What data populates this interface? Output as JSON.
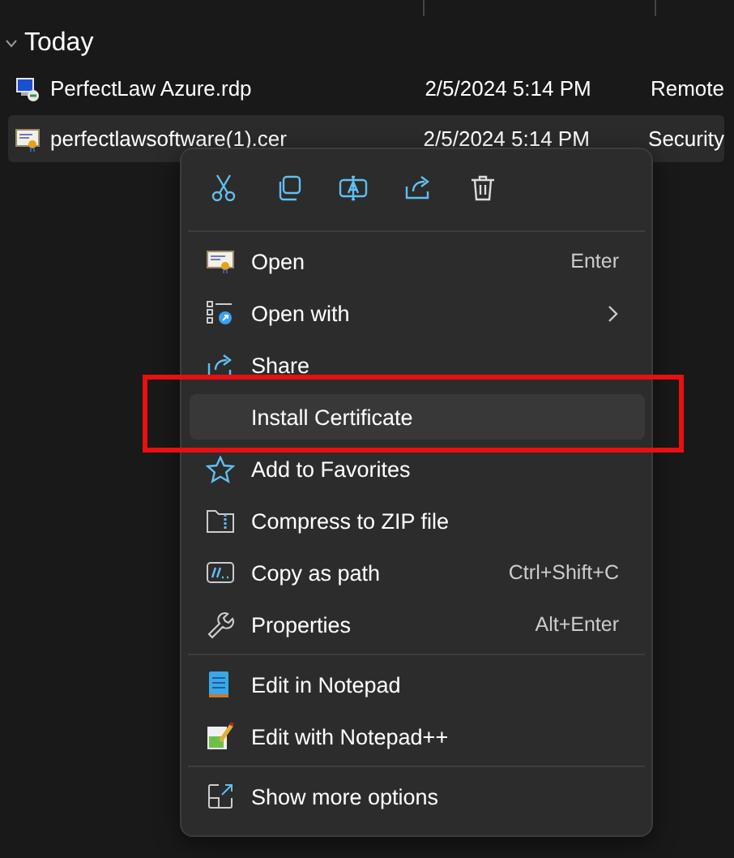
{
  "group": {
    "label": "Today",
    "expanded": true
  },
  "files": [
    {
      "name": "PerfectLaw Azure.rdp",
      "date": "2/5/2024 5:14 PM",
      "type": "Remote",
      "selected": false
    },
    {
      "name": "perfectlawsoftware(1).cer",
      "date": "2/5/2024 5:14 PM",
      "type": "Security",
      "selected": true
    }
  ],
  "context_menu": {
    "sections": [
      [
        {
          "label": "Open",
          "shortcut": "Enter",
          "submenu": false,
          "hovered": false,
          "annotated": false
        },
        {
          "label": "Open with",
          "submenu": true,
          "hovered": false,
          "annotated": false
        },
        {
          "label": "Share",
          "submenu": false,
          "hovered": false,
          "annotated": false
        },
        {
          "label": "Install Certificate",
          "submenu": false,
          "hovered": true,
          "annotated": true
        },
        {
          "label": "Add to Favorites",
          "submenu": false,
          "hovered": false,
          "annotated": false
        },
        {
          "label": "Compress to ZIP file",
          "submenu": false,
          "hovered": false,
          "annotated": false
        },
        {
          "label": "Copy as path",
          "shortcut": "Ctrl+Shift+C",
          "submenu": false,
          "hovered": false,
          "annotated": false
        },
        {
          "label": "Properties",
          "shortcut": "Alt+Enter",
          "submenu": false,
          "hovered": false,
          "annotated": false
        }
      ],
      [
        {
          "label": "Edit in Notepad",
          "submenu": false,
          "hovered": false,
          "annotated": false
        },
        {
          "label": "Edit with Notepad++",
          "submenu": false,
          "hovered": false,
          "annotated": false
        }
      ],
      [
        {
          "label": "Show more options",
          "submenu": false,
          "hovered": false,
          "annotated": false
        }
      ]
    ]
  }
}
